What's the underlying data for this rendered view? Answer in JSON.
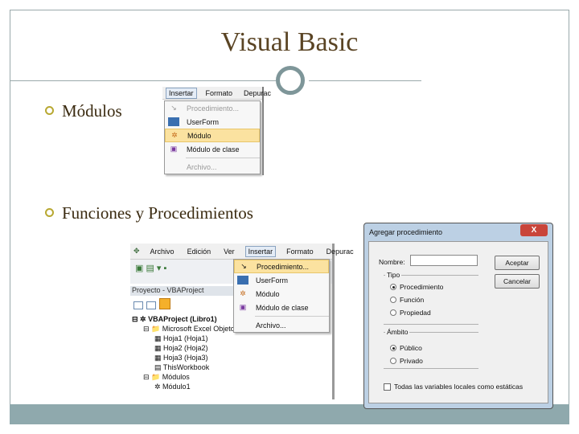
{
  "slide": {
    "title": "Visual Basic",
    "bullets": [
      "Módulos",
      "Funciones y Procedimientos"
    ]
  },
  "shot1": {
    "menubar": [
      "Insertar",
      "Formato",
      "Depurac"
    ],
    "menu": [
      "Procedimiento...",
      "UserForm",
      "Módulo",
      "Módulo de clase",
      "Archivo..."
    ]
  },
  "shot2": {
    "menubar": [
      "Archivo",
      "Edición",
      "Ver",
      "Insertar",
      "Formato",
      "Depurac"
    ],
    "panel_title": "Proyecto - VBAProject",
    "menu": [
      "Procedimiento...",
      "UserForm",
      "Módulo",
      "Módulo de clase",
      "Archivo..."
    ],
    "tree": [
      "VBAProject (Libro1)",
      "Microsoft Excel Objetos",
      "Hoja1 (Hoja1)",
      "Hoja2 (Hoja2)",
      "Hoja3 (Hoja3)",
      "ThisWorkbook",
      "Módulos",
      "Módulo1"
    ]
  },
  "dialog": {
    "title": "Agregar procedimiento",
    "close": "X",
    "name_label": "Nombre:",
    "name_value": "",
    "ok": "Aceptar",
    "cancel": "Cancelar",
    "tipo_label": "Tipo",
    "tipo": [
      "Procedimiento",
      "Función",
      "Propiedad"
    ],
    "ambito_label": "Ámbito",
    "ambito": [
      "Público",
      "Privado"
    ],
    "static_label": "Todas las variables locales como estáticas"
  }
}
